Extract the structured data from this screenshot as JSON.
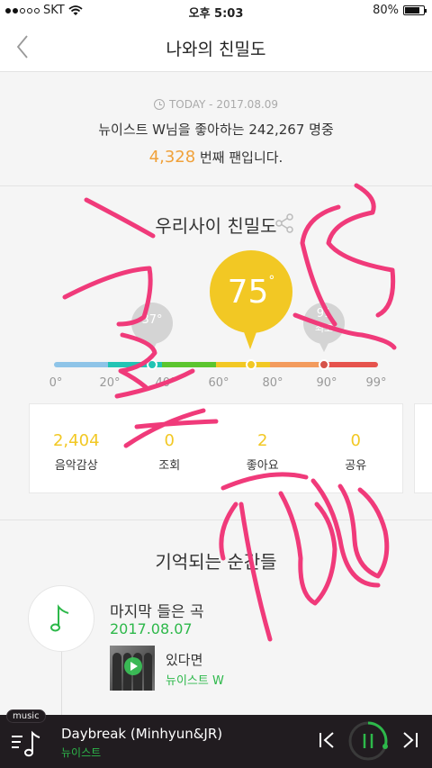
{
  "status_bar": {
    "carrier": "SKT",
    "time": "오후 5:03",
    "battery": "80%",
    "battery_level": 0.8
  },
  "header": {
    "title": "나와의 친밀도"
  },
  "summary": {
    "today": "TODAY - 2017.08.09",
    "line1": "뉴이스트 W님을 좋아하는 242,267 명중",
    "rank": "4,328",
    "line2_suffix": " 번째 팬입니다."
  },
  "intimacy": {
    "title": "우리사이 친밀도",
    "current": "75",
    "degree": "°",
    "previous": "37°",
    "best_value": "91",
    "best_label": "최고",
    "scale_ticks": [
      "0°",
      "20°",
      "40°",
      "60°",
      "80°",
      "90°",
      "99°"
    ],
    "scale_colors": [
      "#8ec4e8",
      "#22c4b4",
      "#5bc52e",
      "#f2c824",
      "#f39b5d",
      "#e6534d"
    ],
    "stats": [
      {
        "value": "2,404",
        "label": "음악감상"
      },
      {
        "value": "0",
        "label": "조회"
      },
      {
        "value": "2",
        "label": "좋아요"
      },
      {
        "value": "0",
        "label": "공유"
      }
    ]
  },
  "memories": {
    "title": "기억되는 순간들",
    "item_title": "마지막 들은 곡",
    "item_date": "2017.08.07",
    "song_title": "있다면",
    "song_artist": "뉴이스트 W"
  },
  "player": {
    "tag": "music",
    "track": "Daybreak (Minhyun&JR)",
    "artist": "뉴이스트",
    "accent_color": "#2db84a"
  }
}
